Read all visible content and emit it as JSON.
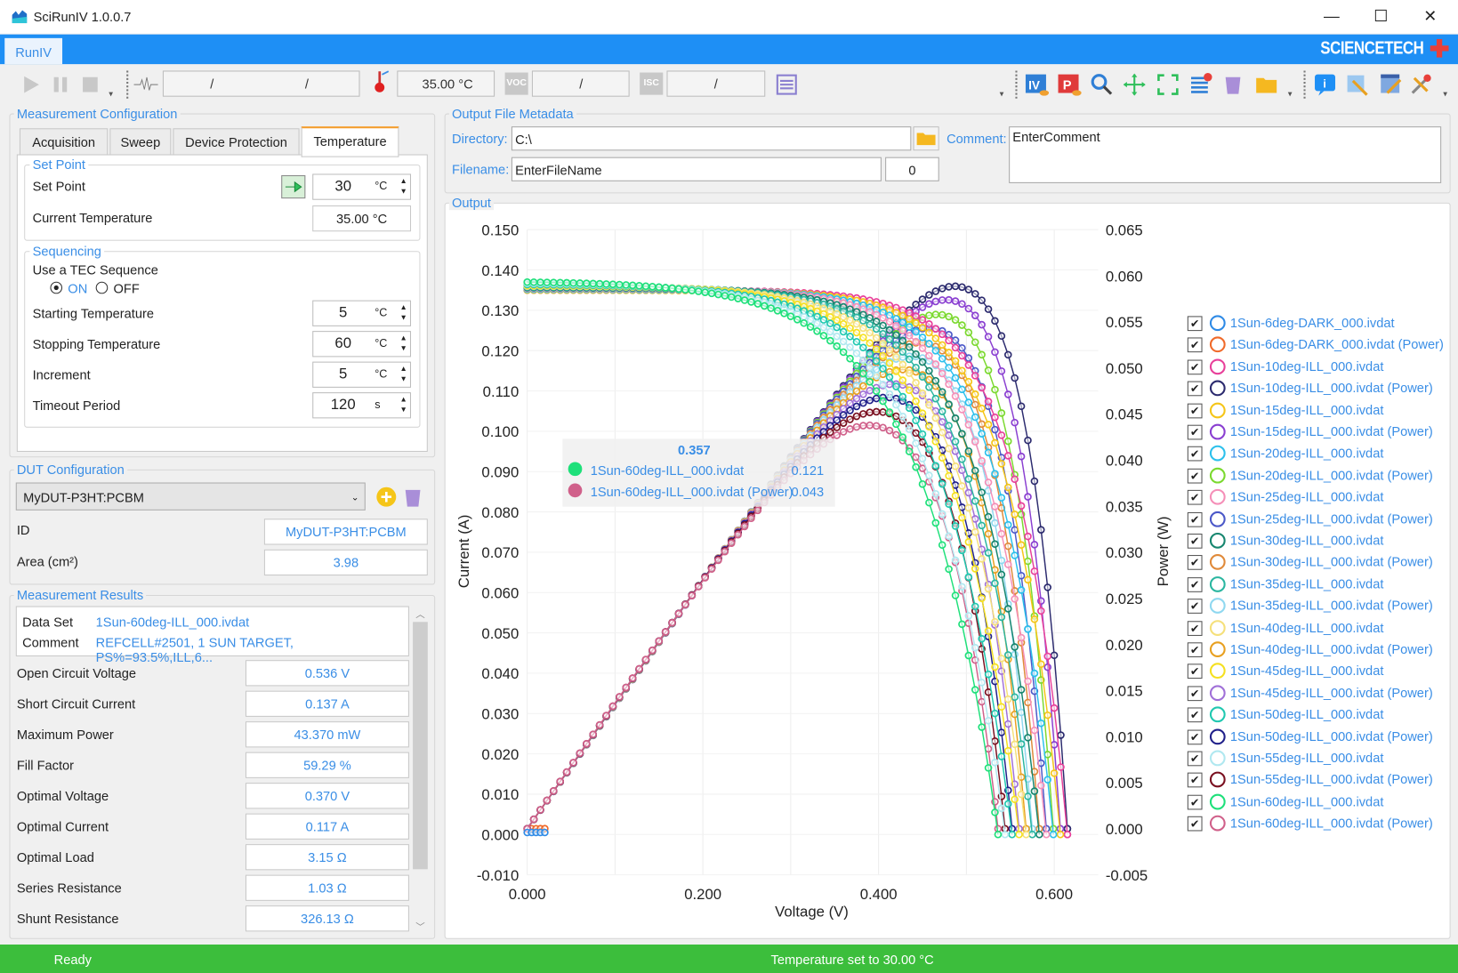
{
  "window": {
    "title": "SciRunIV 1.0.0.7",
    "minimize": "—",
    "maximize": "☐",
    "close": "✕"
  },
  "ribbon": {
    "tab": "RunIV",
    "brand": "SCIENCETECH"
  },
  "toolbar": {
    "waveform_field": [
      "/",
      "/"
    ],
    "temperature": "35.00 °C",
    "voc_badge": "VOC",
    "voc": "/",
    "isc_badge": "ISC",
    "isc": "/",
    "icons": [
      "play-icon",
      "pause-icon",
      "stop-icon",
      "waveform-icon",
      "thermometer-icon",
      "table-icon",
      "iv-plot-icon",
      "power-plot-icon",
      "zoom-icon",
      "pan-icon",
      "fit-icon",
      "clear-list-icon",
      "trash-icon",
      "folder-icon",
      "info-icon",
      "edit-icon",
      "window-edit-icon",
      "settings-icon"
    ]
  },
  "measurement_configuration": {
    "title": "Measurement Configuration",
    "tabs": [
      "Acquisition",
      "Sweep",
      "Device Protection",
      "Temperature"
    ],
    "active_tab": "Temperature",
    "set_point": {
      "group_title": "Set Point",
      "label": "Set Point",
      "value": "30",
      "unit": "°C"
    },
    "current_temperature": {
      "label": "Current Temperature",
      "value": "35.00 °C"
    },
    "sequencing": {
      "group_title": "Sequencing",
      "use_tec_label": "Use a TEC Sequence",
      "on_label": "ON",
      "off_label": "OFF",
      "selected": "ON",
      "rows": [
        {
          "label": "Starting Temperature",
          "value": "5",
          "unit": "°C"
        },
        {
          "label": "Stopping Temperature",
          "value": "60",
          "unit": "°C"
        },
        {
          "label": "Increment",
          "value": "5",
          "unit": "°C"
        },
        {
          "label": "Timeout Period",
          "value": "120",
          "unit": "s"
        }
      ]
    }
  },
  "dut": {
    "title": "DUT Configuration",
    "selected": "MyDUT-P3HT:PCBM",
    "id_label": "ID",
    "id_value": "MyDUT-P3HT:PCBM",
    "area_label": "Area (cm²)",
    "area_value": "3.98"
  },
  "results": {
    "title": "Measurement Results",
    "data_set_label": "Data Set",
    "data_set": "1Sun-60deg-ILL_000.ivdat",
    "comment_label": "Comment",
    "comment": "REFCELL#2501, 1 SUN TARGET, PS%=93.5%,ILL,6...",
    "rows": [
      {
        "label": "Open Circuit Voltage",
        "value": "0.536 V"
      },
      {
        "label": "Short Circuit Current",
        "value": "0.137 A"
      },
      {
        "label": "Maximum Power",
        "value": "43.370 mW"
      },
      {
        "label": "Fill Factor",
        "value": "59.29 %"
      },
      {
        "label": "Optimal Voltage",
        "value": "0.370 V"
      },
      {
        "label": "Optimal Current",
        "value": "0.117 A"
      },
      {
        "label": "Optimal Load",
        "value": "3.15 Ω"
      },
      {
        "label": "Series Resistance",
        "value": "1.03 Ω"
      },
      {
        "label": "Shunt Resistance",
        "value": "326.13 Ω"
      }
    ]
  },
  "output_metadata": {
    "title": "Output File Metadata",
    "directory_label": "Directory:",
    "directory": "C:\\",
    "comment_label": "Comment:",
    "comment": "EnterComment",
    "filename_label": "Filename:",
    "filename": "EnterFileName",
    "index": "0"
  },
  "output": {
    "title": "Output",
    "tooltip": {
      "x": "0.357",
      "rows": [
        {
          "name": "1Sun-60deg-ILL_000.ivdat",
          "value": "0.121",
          "color": "#1ee07a"
        },
        {
          "name": "1Sun-60deg-ILL_000.ivdat (Power)",
          "value": "0.043",
          "color": "#d0608a"
        }
      ]
    }
  },
  "chart_data": {
    "type": "scatter",
    "xlabel": "Voltage (V)",
    "ylabel": "Current (A)",
    "y2label": "Power (W)",
    "xlim": [
      0,
      0.65
    ],
    "ylim": [
      -0.01,
      0.15
    ],
    "y2lim": [
      -0.005,
      0.065
    ],
    "x_ticks": [
      0,
      0.2,
      0.4,
      0.6
    ],
    "y_ticks": [
      -0.01,
      0,
      0.01,
      0.02,
      0.03,
      0.04,
      0.05,
      0.06,
      0.07,
      0.08,
      0.09,
      0.1,
      0.11,
      0.12,
      0.13,
      0.14,
      0.15
    ],
    "y2_ticks": [
      -0.005,
      0,
      0.005,
      0.01,
      0.015,
      0.02,
      0.025,
      0.03,
      0.035,
      0.04,
      0.045,
      0.05,
      0.055,
      0.06,
      0.065
    ],
    "grid": true,
    "legend_position": "right",
    "datasets": [
      {
        "name": "1Sun-6deg-DARK_000.ivdat",
        "power_name": "1Sun-6deg-DARK_000.ivdat (Power)",
        "color": "#2e8ae6",
        "power_color": "#f06a2a",
        "points": [
          [
            0,
            0.0005
          ],
          [
            0.005,
            0.0005
          ],
          [
            0.01,
            0.0005
          ],
          [
            0.015,
            0.0005
          ],
          [
            0.02,
            0.0005
          ]
        ]
      },
      {
        "name": "1Sun-10deg-ILL_000.ivdat",
        "power_name": "1Sun-10deg-ILL_000.ivdat (Power)",
        "color": "#e8409a",
        "power_color": "#2b2a6e",
        "isc": 0.135,
        "voc": 0.615,
        "vmp": 0.48,
        "pmax": 0.0588
      },
      {
        "name": "1Sun-15deg-ILL_000.ivdat",
        "power_name": "1Sun-15deg-ILL_000.ivdat (Power)",
        "color": "#f5c518",
        "power_color": "#8a3fd1",
        "isc": 0.135,
        "voc": 0.607,
        "vmp": 0.469,
        "pmax": 0.0573
      },
      {
        "name": "1Sun-20deg-ILL_000.ivdat",
        "power_name": "1Sun-20deg-ILL_000.ivdat (Power)",
        "color": "#2cc0ec",
        "power_color": "#7bd92f",
        "isc": 0.1352,
        "voc": 0.599,
        "vmp": 0.458,
        "pmax": 0.0557
      },
      {
        "name": "1Sun-25deg-ILL_000.ivdat",
        "power_name": "1Sun-25deg-ILL_000.ivdat (Power)",
        "color": "#f58fb8",
        "power_color": "#4b58c8",
        "isc": 0.1354,
        "voc": 0.591,
        "vmp": 0.447,
        "pmax": 0.0542
      },
      {
        "name": "1Sun-30deg-ILL_000.ivdat",
        "power_name": "1Sun-30deg-ILL_000.ivdat (Power)",
        "color": "#17866f",
        "power_color": "#e08a3a",
        "isc": 0.1356,
        "voc": 0.583,
        "vmp": 0.436,
        "pmax": 0.0526
      },
      {
        "name": "1Sun-35deg-ILL_000.ivdat",
        "power_name": "1Sun-35deg-ILL_000.ivdat (Power)",
        "color": "#2ab6a0",
        "power_color": "#8fd8f0",
        "isc": 0.1358,
        "voc": 0.575,
        "vmp": 0.425,
        "pmax": 0.0511
      },
      {
        "name": "1Sun-40deg-ILL_000.ivdat",
        "power_name": "1Sun-40deg-ILL_000.ivdat (Power)",
        "color": "#f5e07a",
        "power_color": "#e8a020",
        "isc": 0.136,
        "voc": 0.568,
        "vmp": 0.414,
        "pmax": 0.0496
      },
      {
        "name": "1Sun-45deg-ILL_000.ivdat",
        "power_name": "1Sun-45deg-ILL_000.ivdat (Power)",
        "color": "#f5e020",
        "power_color": "#a070d8",
        "isc": 0.1362,
        "voc": 0.56,
        "vmp": 0.403,
        "pmax": 0.048
      },
      {
        "name": "1Sun-50deg-ILL_000.ivdat",
        "power_name": "1Sun-50deg-ILL_000.ivdat (Power)",
        "color": "#20c8b0",
        "power_color": "#20208a",
        "isc": 0.1364,
        "voc": 0.552,
        "vmp": 0.392,
        "pmax": 0.0465
      },
      {
        "name": "1Sun-55deg-ILL_000.ivdat",
        "power_name": "1Sun-55deg-ILL_000.ivdat (Power)",
        "color": "#b0e8f0",
        "power_color": "#7a1020",
        "isc": 0.1367,
        "voc": 0.544,
        "vmp": 0.381,
        "pmax": 0.0449
      },
      {
        "name": "1Sun-60deg-ILL_000.ivdat",
        "power_name": "1Sun-60deg-ILL_000.ivdat (Power)",
        "color": "#1ee07a",
        "power_color": "#d0608a",
        "isc": 0.137,
        "voc": 0.536,
        "vmp": 0.37,
        "pmax": 0.04337
      }
    ]
  },
  "status": {
    "left": "Ready",
    "center": "Temperature set to 30.00 °C"
  },
  "colors": {
    "ribbon": "#1e8ff5",
    "accent": "#3a8ee6",
    "status_bar": "#3cbe3c",
    "active_tab": "#f39c2c"
  }
}
